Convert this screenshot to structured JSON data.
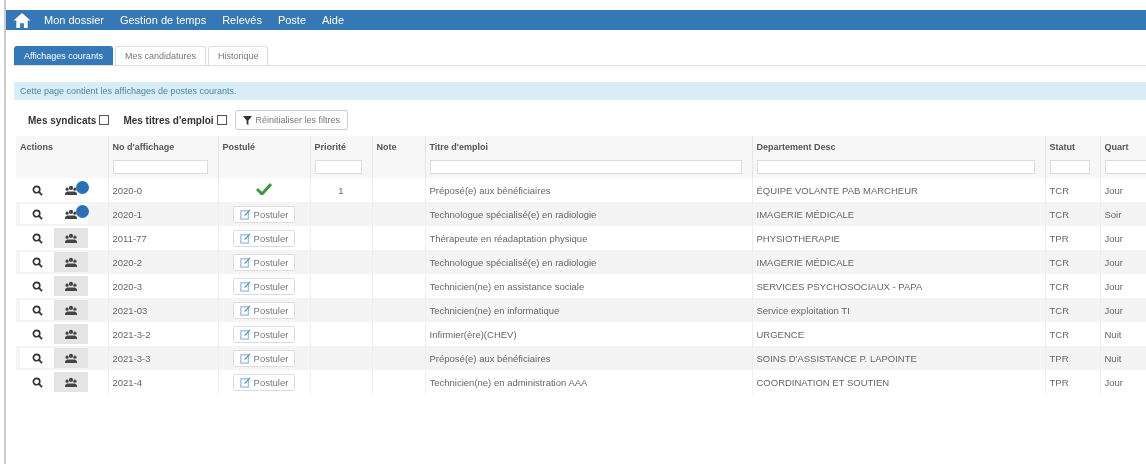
{
  "nav": {
    "items": [
      "Mon dossier",
      "Gestion de temps",
      "Relevés",
      "Poste",
      "Aide"
    ]
  },
  "tabs": [
    {
      "label": "Affichages courants",
      "selected": true
    },
    {
      "label": "Mes candidatures",
      "selected": false
    },
    {
      "label": "Historique",
      "selected": false
    }
  ],
  "info": "Cette page contient les affichages de postes courants.",
  "filters": [
    {
      "label": "Mes syndicats",
      "checked": false
    },
    {
      "label": "Mes titres d'emploi",
      "checked": false
    }
  ],
  "reset_button": "Réinitialiser les filtres",
  "table": {
    "columns": [
      {
        "label": "Actions",
        "filter": false
      },
      {
        "label": "No d'affichage",
        "filter": true
      },
      {
        "label": "Postulé",
        "filter": false
      },
      {
        "label": "Priorité",
        "filter": true
      },
      {
        "label": "Note",
        "filter": false
      },
      {
        "label": "Titre d'emploi",
        "filter": true
      },
      {
        "label": "Departement Desc",
        "filter": true
      },
      {
        "label": "Statut",
        "filter": true
      },
      {
        "label": "Quart",
        "filter": true
      }
    ],
    "rows": [
      {
        "badge": true,
        "number": "2020-0",
        "applied": true,
        "priority": "1",
        "title": "Préposé(e) aux bénéficiaires",
        "department": "ÉQUIPE VOLANTE PAB MARCHEUR",
        "status": "TCR",
        "shift": "Jour"
      },
      {
        "badge": true,
        "number": "2020-1",
        "applied": false,
        "apply_label": "Postuler",
        "title": "Technologue spécialisé(e) en radiologie",
        "department": "IMAGERIE MÉDICALE",
        "status": "TCR",
        "shift": "Soir"
      },
      {
        "badge": false,
        "number": "2011-77",
        "applied": false,
        "apply_label": "Postuler",
        "title": "Thérapeute en réadaptation physique",
        "department": "PHYSIOTHERAPIE",
        "status": "TPR",
        "shift": "Jour"
      },
      {
        "badge": false,
        "number": "2020-2",
        "applied": false,
        "apply_label": "Postuler",
        "title": "Technologue spécialisé(e) en radiologie",
        "department": "IMAGERIE MÉDICALE",
        "status": "TCR",
        "shift": "Jour"
      },
      {
        "badge": false,
        "number": "2020-3",
        "applied": false,
        "apply_label": "Postuler",
        "title": "Technicien(ne) en assistance sociale",
        "department": "SERVICES PSYCHOSOCIAUX - PAPA",
        "status": "TCR",
        "shift": "Jour"
      },
      {
        "badge": false,
        "number": "2021-03",
        "applied": false,
        "apply_label": "Postuler",
        "title": "Technicien(ne) en informatique",
        "department": "Service exploitation TI",
        "status": "TCR",
        "shift": "Jour"
      },
      {
        "badge": false,
        "number": "2021-3-2",
        "applied": false,
        "apply_label": "Postuler",
        "title": "Infirmier(ère)(CHEV)",
        "department": "URGENCE",
        "status": "TCR",
        "shift": "Nuit"
      },
      {
        "badge": false,
        "number": "2021-3-3",
        "applied": false,
        "apply_label": "Postuler",
        "title": "Préposé(e) aux bénéficiaires",
        "department": "SOINS D'ASSISTANCE P. LAPOINTE",
        "status": "TPR",
        "shift": "Nuit"
      },
      {
        "badge": false,
        "number": "2021-4",
        "applied": false,
        "apply_label": "Postuler",
        "title": "Technicien(ne) en administration AAA",
        "department": "COORDINATION ET SOUTIEN",
        "status": "TPR",
        "shift": "Jour"
      }
    ]
  }
}
